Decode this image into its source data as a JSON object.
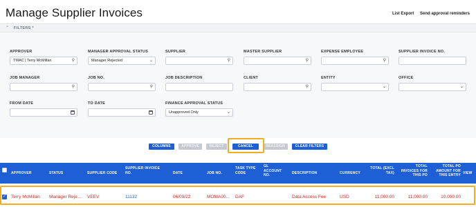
{
  "header": {
    "title": "Manage Supplier Invoices",
    "list_export": "List Export",
    "send_reminders": "Send approval reminders"
  },
  "filters_bar": {
    "label": "FILTERS *"
  },
  "filters": {
    "approver": {
      "label": "APPROVER",
      "value": "TMAC | Terry McMillan"
    },
    "manager_approval_status": {
      "label": "MANAGER APPROVAL STATUS",
      "value": "Manager Rejected"
    },
    "supplier": {
      "label": "SUPPLIER",
      "value": ""
    },
    "master_supplier": {
      "label": "MASTER SUPPLIER",
      "value": ""
    },
    "expense_employee": {
      "label": "EXPENSE EMPLOYEE",
      "value": ""
    },
    "supplier_invoice_no": {
      "label": "SUPPLIER INVOICE NO.",
      "value": ""
    },
    "job_manager": {
      "label": "JOB MANAGER",
      "value": ""
    },
    "job_no": {
      "label": "JOB NO.",
      "value": ""
    },
    "job_description": {
      "label": "JOB DESCRIPTION",
      "value": ""
    },
    "client": {
      "label": "CLIENT",
      "value": ""
    },
    "entity": {
      "label": "ENTITY",
      "value": ""
    },
    "office": {
      "label": "OFFICE",
      "value": ""
    },
    "from_date": {
      "label": "FROM DATE",
      "value": ""
    },
    "to_date": {
      "label": "TO DATE",
      "value": ""
    },
    "finance_approval_status": {
      "label": "FINANCE APPROVAL STATUS",
      "value": "Unapproved Only"
    }
  },
  "toolbar": {
    "columns": "COLUMNS",
    "approve": "APPROVE",
    "reject": "REJECT",
    "cancel": "CANCEL",
    "reassign": "REASSIGN",
    "clear_filters": "CLEAR FILTERS"
  },
  "table": {
    "headers": {
      "approver": "APPROVER",
      "status": "STATUS",
      "supplier_code": "SUPPLIER CODE",
      "supplier_invoice_no_1": "SUPPLIER INVOICE",
      "supplier_invoice_no_2": "NO.",
      "date": "DATE",
      "job_no": "JOB NO.",
      "task_type_1": "TASK TYPE",
      "task_type_2": "CODE",
      "gl_1": "GL",
      "gl_2": "ACCOUNT",
      "gl_3": "NO.",
      "description": "DESCRIPTION",
      "currency": "CURRENCY",
      "total_1": "TOTAL (EXCL",
      "total_2": "TAX)",
      "tip_1": "TOTAL",
      "tip_2": "INVOICES FOR",
      "tip_3": "THIS PO",
      "tpo_1": "TOTAL PO",
      "tpo_2": "AMOUNT FOR",
      "tpo_3": "THIS ENTRY",
      "view": "VIEW"
    },
    "row": {
      "approver": "Terry McMillan",
      "status": "Manager Reje...",
      "supplier_code": "VEEV",
      "supplier_invoice_no": "11132",
      "date": "06/09/22",
      "job_no": "MOMA00...",
      "task_type_code": "DAF",
      "gl_account_no": "",
      "description": "Data Access Fee",
      "currency": "USD",
      "total_excl_tax": "11,000.00",
      "total_invoices_po": "11,000.00",
      "total_po_amount": "10,000.00"
    }
  },
  "colors": {
    "primary_blue": "#1f5fd6",
    "highlight_orange": "#f2ad23",
    "row_text_red": "#d9261c",
    "disabled_gray": "#c6cad0"
  }
}
